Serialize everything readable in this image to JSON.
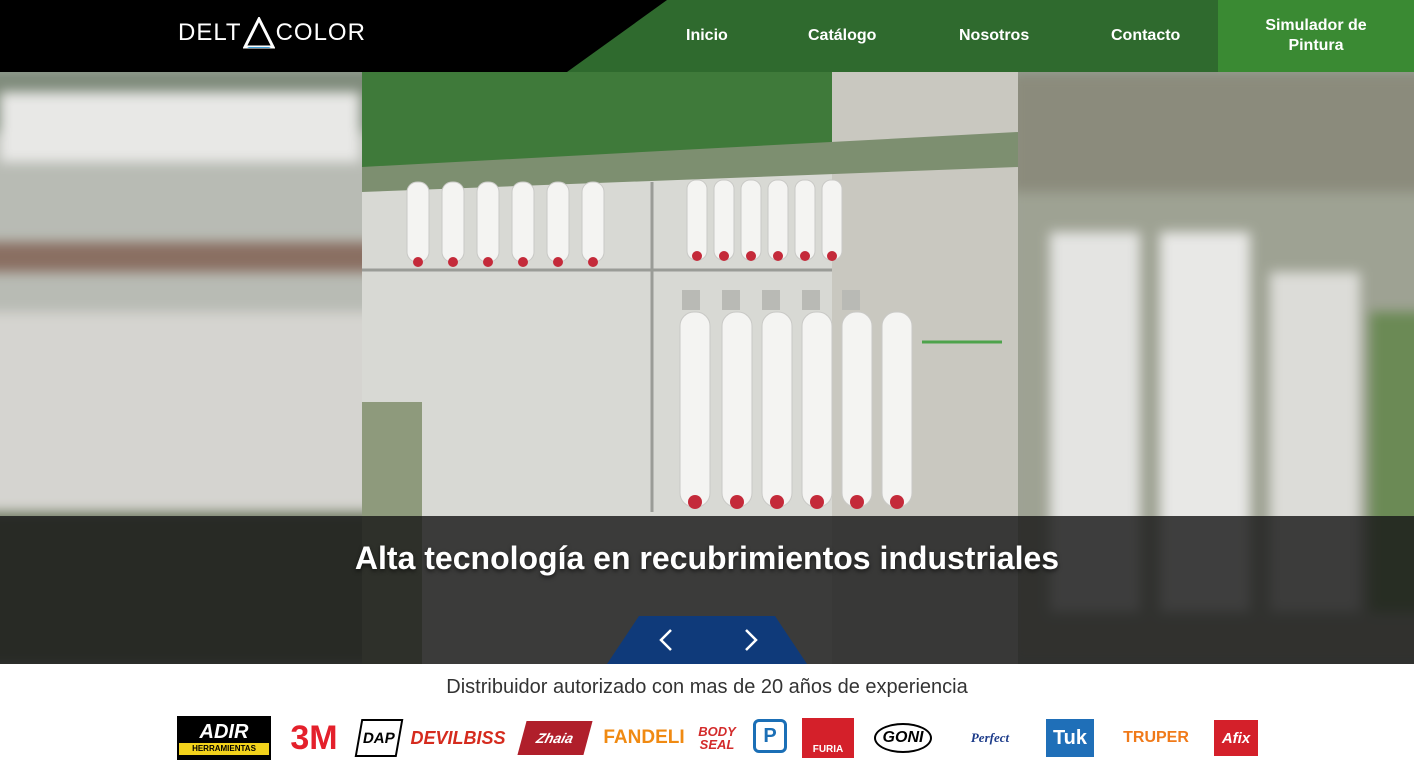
{
  "header": {
    "logo_left": "DELT",
    "logo_right": "COLOR",
    "nav": [
      {
        "label": "Inicio"
      },
      {
        "label": "Catálogo"
      },
      {
        "label": "Nosotros"
      },
      {
        "label": "Contacto"
      }
    ],
    "cta_label": "Simulador de Pintura"
  },
  "hero": {
    "caption": "Alta tecnología en recubrimientos industriales"
  },
  "brands_section": {
    "tagline": "Distribuidor autorizado con mas de 20 años de experiencia",
    "brands": [
      {
        "name": "ADIR",
        "sub": "HERRAMIENTAS"
      },
      {
        "name": "3M"
      },
      {
        "name": "DAP"
      },
      {
        "name": "DEVILBISS"
      },
      {
        "name": "Zhaia"
      },
      {
        "name": "FANDELI"
      },
      {
        "name": "BODY SEAL"
      },
      {
        "name": "P"
      },
      {
        "name": "FURIA"
      },
      {
        "name": "GONI"
      },
      {
        "name": "Perfect"
      },
      {
        "name": "Tuk"
      },
      {
        "name": "TRUPER"
      },
      {
        "name": "Afix"
      }
    ]
  },
  "colors": {
    "header_green": "#2f6a2e",
    "cta_green": "#3a8a33",
    "slider_blue": "#0f3a7a"
  }
}
